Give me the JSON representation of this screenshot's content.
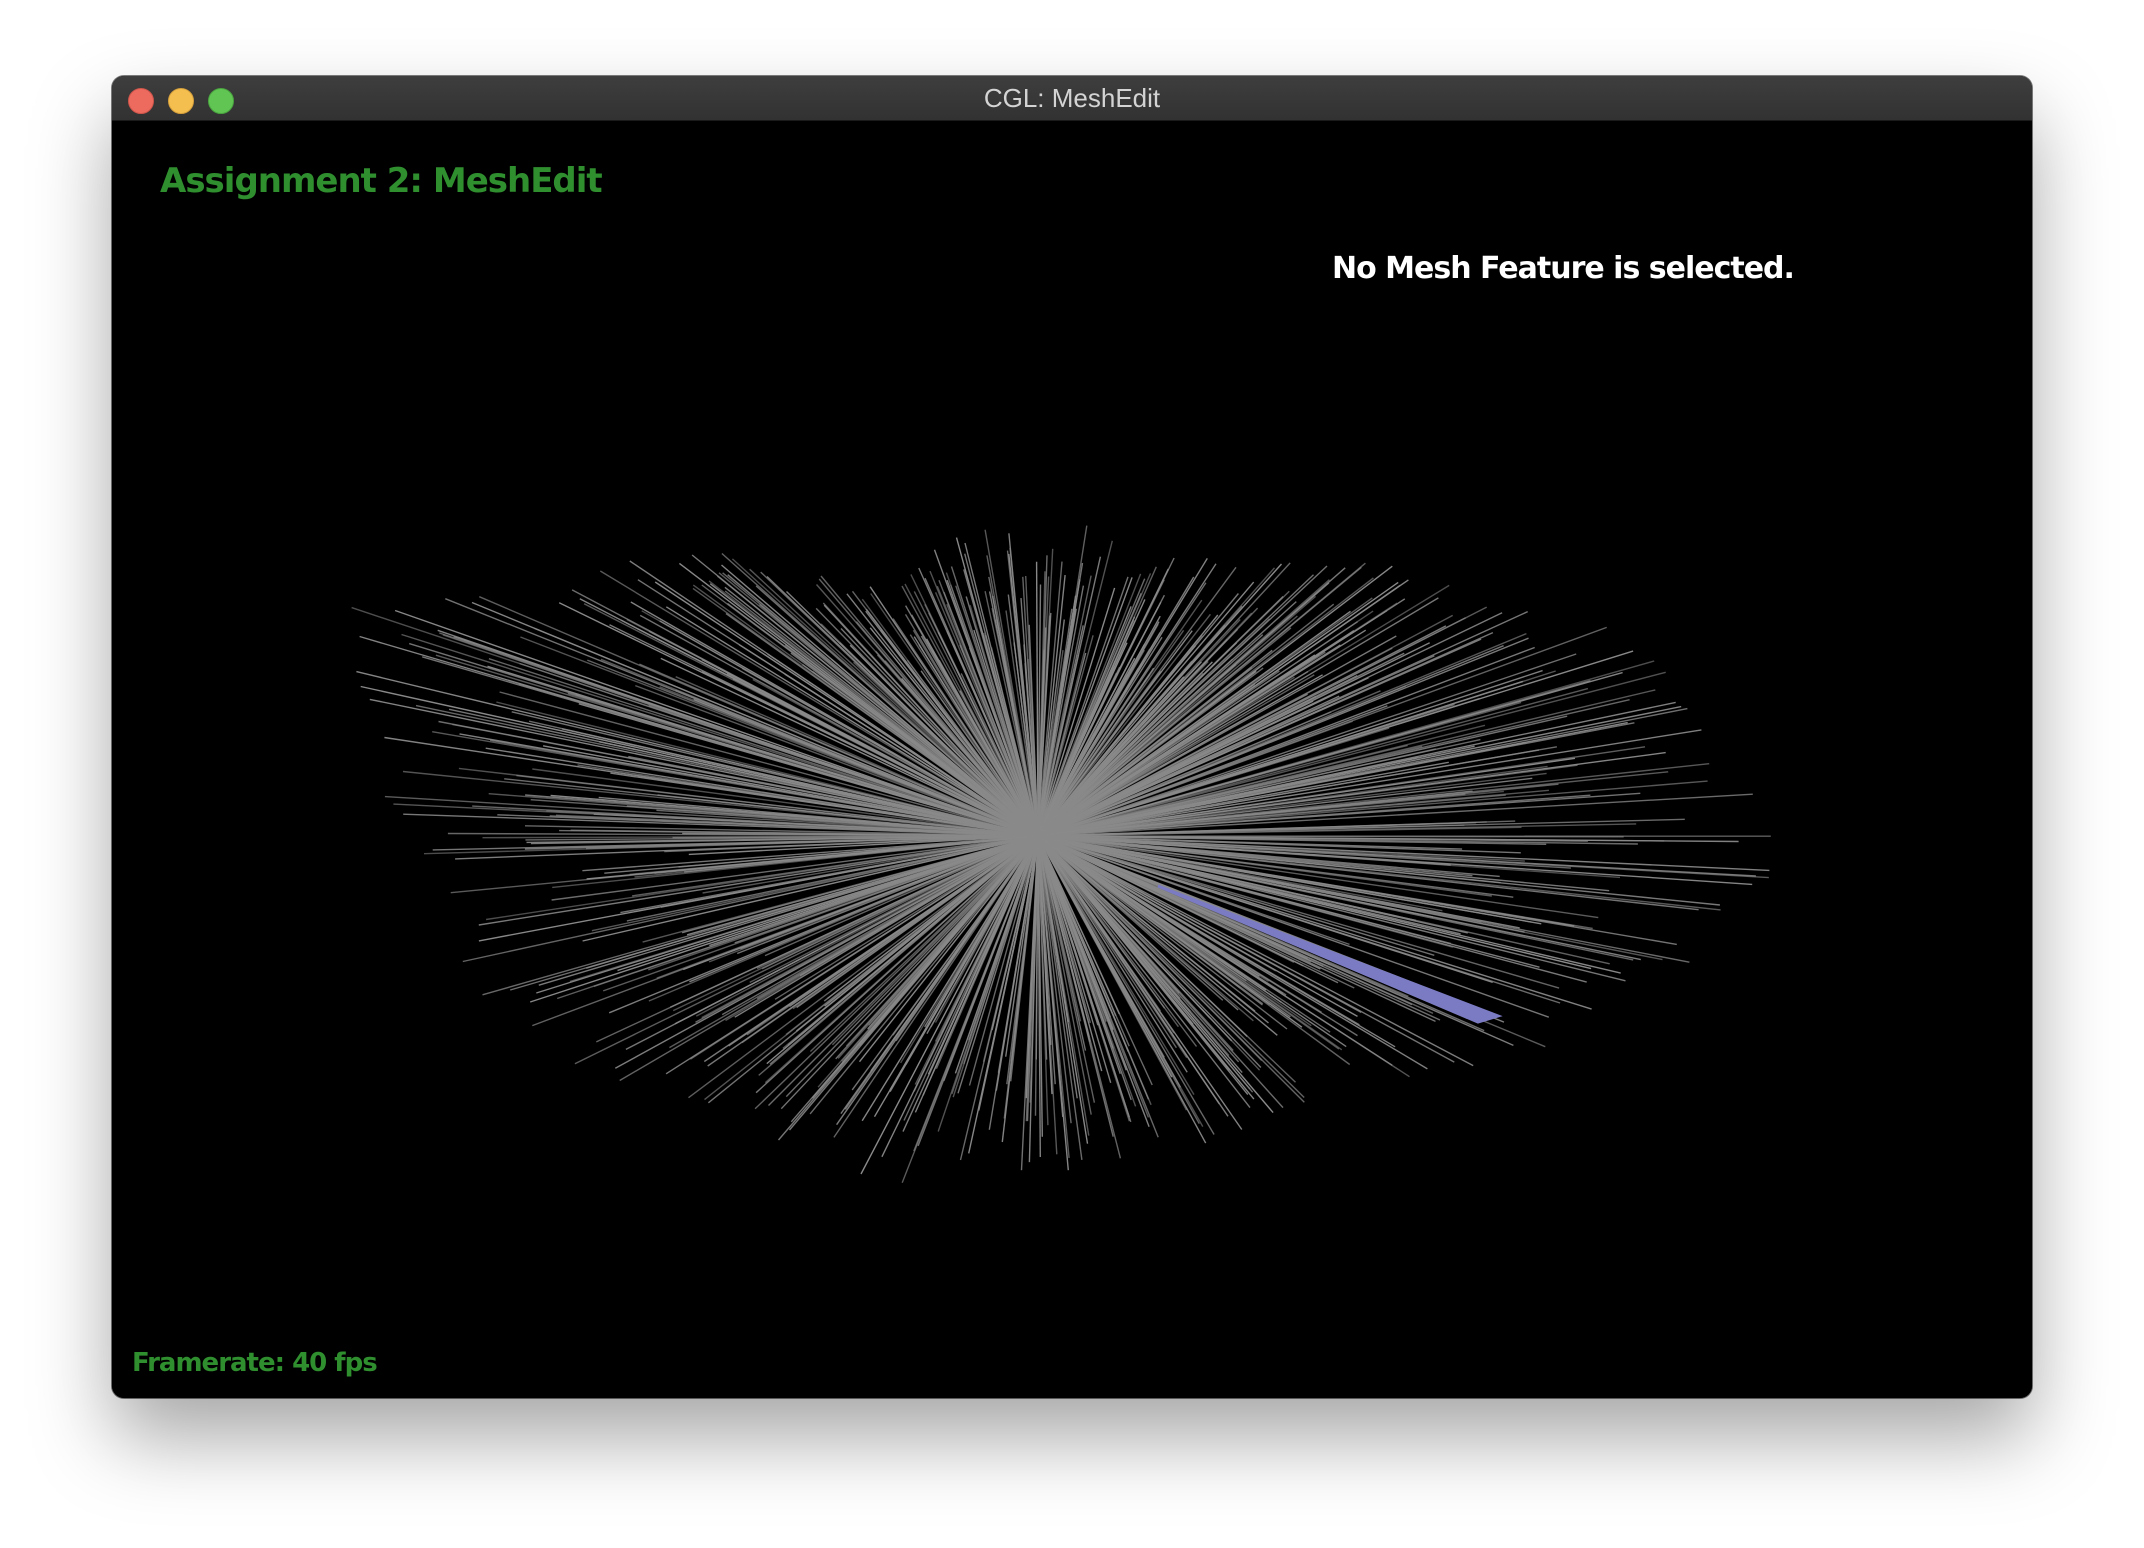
{
  "window": {
    "title": "CGL: MeshEdit"
  },
  "viewport": {
    "heading": "Assignment 2: MeshEdit",
    "selection_status": "No Mesh Feature is selected.",
    "framerate": "Framerate: 40 fps"
  },
  "colors": {
    "background": "#000000",
    "heading_green": "#2f8f2f",
    "mesh_edge": "#8a8a8a",
    "hover_face": "#7b7bc4"
  },
  "icons": [
    "close-icon",
    "minimize-icon",
    "maximize-icon"
  ]
}
